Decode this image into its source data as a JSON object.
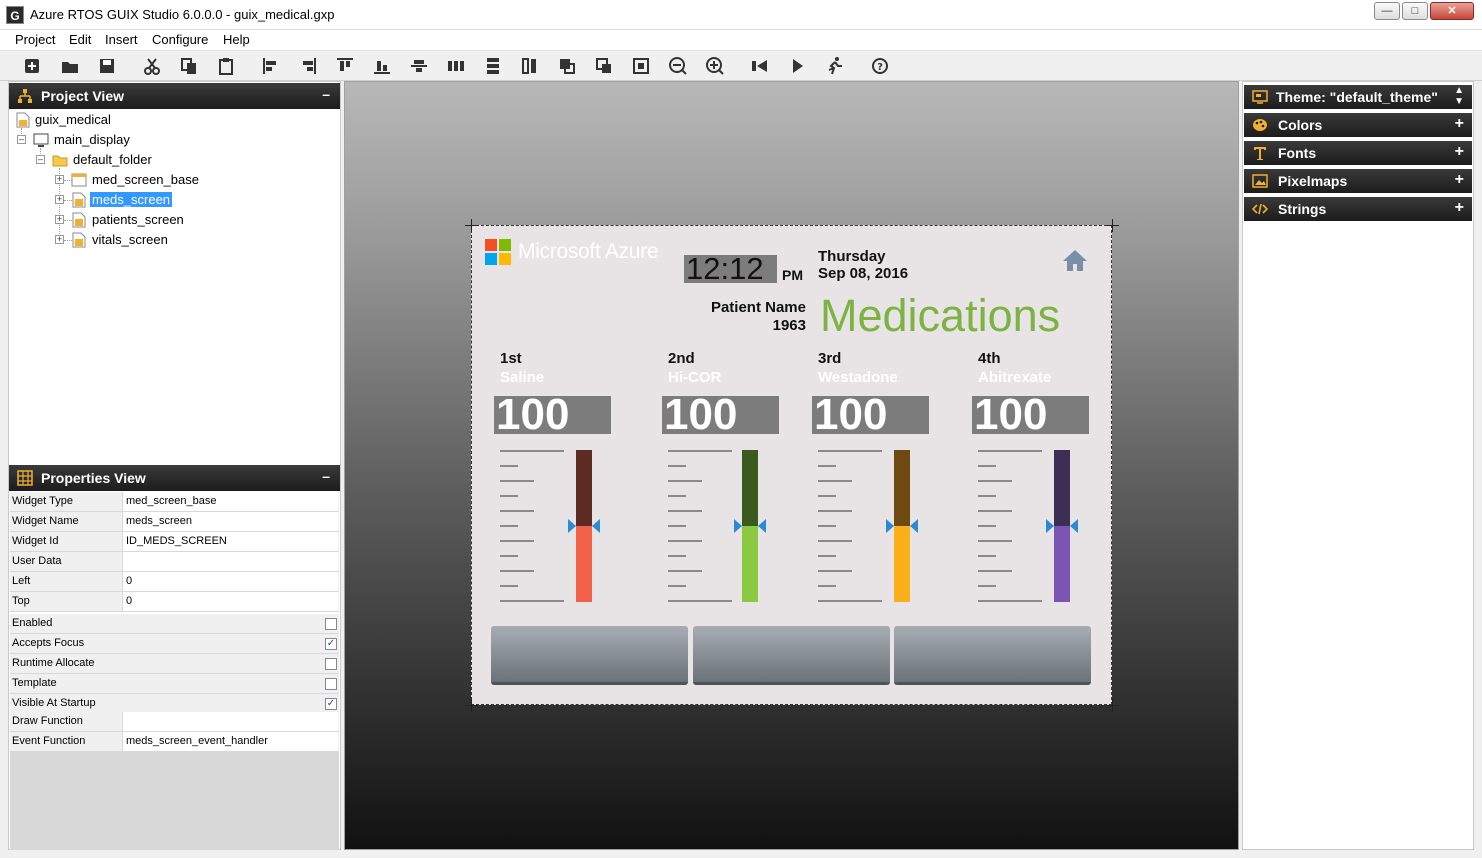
{
  "window": {
    "title": "Azure RTOS GUIX Studio 6.0.0.0 - guix_medical.gxp",
    "app_icon_text": "G",
    "minimize": "—",
    "maximize": "□",
    "close": "✕"
  },
  "menu": [
    "Project",
    "Edit",
    "Insert",
    "Configure",
    "Help"
  ],
  "toolbar_icons": [
    "new-icon",
    "open-icon",
    "save-icon",
    "cut-icon",
    "copy-icon",
    "paste-icon",
    "align-left-icon",
    "align-right-icon",
    "align-top-icon",
    "align-bottom-icon",
    "vcenter-icon",
    "hspace-icon",
    "vspace-icon",
    "equal-width-icon",
    "move-back-icon",
    "move-front-icon",
    "fit-icon",
    "zoom-out-icon",
    "zoom-in-icon",
    "record-icon",
    "run-icon",
    "test-icon",
    "help-icon"
  ],
  "project_view": {
    "title": "Project View",
    "collapse": "–",
    "tree": {
      "root": "guix_medical",
      "display": "main_display",
      "folder": "default_folder",
      "screens": [
        "med_screen_base",
        "meds_screen",
        "patients_screen",
        "vitals_screen"
      ],
      "selected": "meds_screen"
    }
  },
  "properties_view": {
    "title": "Properties View",
    "collapse": "–",
    "fields": [
      {
        "name": "Widget Type",
        "value": "med_screen_base"
      },
      {
        "name": "Widget Name",
        "value": "meds_screen"
      },
      {
        "name": "Widget Id",
        "value": "ID_MEDS_SCREEN"
      },
      {
        "name": "User Data",
        "value": ""
      },
      {
        "name": "Left",
        "value": "0"
      },
      {
        "name": "Top",
        "value": "0"
      }
    ],
    "checks": [
      {
        "name": "Enabled",
        "checked": ""
      },
      {
        "name": "Accepts Focus",
        "checked": "✓"
      },
      {
        "name": "Runtime Allocate",
        "checked": ""
      },
      {
        "name": "Template",
        "checked": ""
      },
      {
        "name": "Visible At Startup",
        "checked": "✓"
      }
    ],
    "functions": [
      {
        "name": "Draw Function",
        "value": ""
      },
      {
        "name": "Event Function",
        "value": "meds_screen_event_handler"
      }
    ]
  },
  "screen": {
    "brand": "Microsoft Azure",
    "time": "12:12",
    "ampm": "PM",
    "day": "Thursday",
    "date": "Sep 08, 2016",
    "patient_label": "Patient Name",
    "patient_value": "1963",
    "title": "Medications",
    "title_color": "#7cb342",
    "meds": [
      {
        "ordinal": "1st",
        "name": "Saline",
        "value": "100",
        "top_color": "#5c2b22",
        "bottom_color": "#f2604a"
      },
      {
        "ordinal": "2nd",
        "name": "Hi-COR",
        "value": "100",
        "top_color": "#3a5a1e",
        "bottom_color": "#8bc940"
      },
      {
        "ordinal": "3rd",
        "name": "Westadone",
        "value": "100",
        "top_color": "#6e4a12",
        "bottom_color": "#fbb019"
      },
      {
        "ordinal": "4th",
        "name": "Abitrexate",
        "value": "100",
        "top_color": "#3d2e55",
        "bottom_color": "#7a55b2"
      }
    ]
  },
  "resources": {
    "theme": "Theme: \"default_theme\"",
    "sections": [
      "Colors",
      "Fonts",
      "Pixelmaps",
      "Strings"
    ],
    "plus": "+"
  }
}
